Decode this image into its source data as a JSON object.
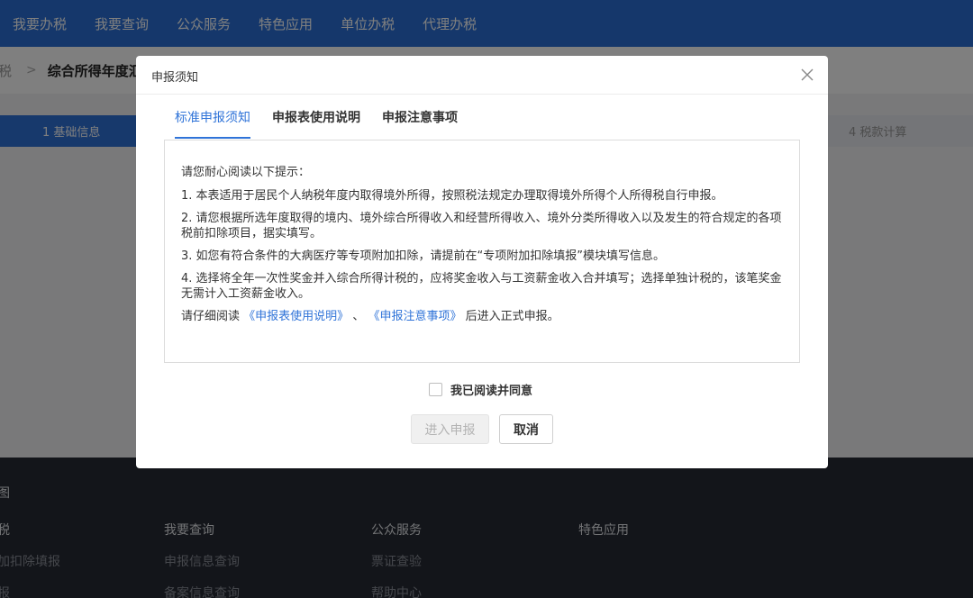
{
  "topnav": {
    "items": [
      "我要办税",
      "我要查询",
      "公众服务",
      "特色应用",
      "单位办税",
      "代理办税"
    ]
  },
  "breadcrumb": {
    "prev": "税",
    "current": "综合所得年度汇"
  },
  "steps": {
    "step1": "1 基础信息",
    "step4": "4 税款计算"
  },
  "footer": {
    "map_title": "图",
    "col1_title": "税",
    "col1_links": [
      "加扣除填报",
      "报"
    ],
    "col2_title": "我要查询",
    "col2_links": [
      "申报信息查询",
      "备案信息查询"
    ],
    "col3_title": "公众服务",
    "col3_links": [
      "票证查验",
      "帮助中心"
    ],
    "col4_title": "特色应用"
  },
  "modal": {
    "title": "申报须知",
    "tabs": [
      "标准申报须知",
      "申报表使用说明",
      "申报注意事项"
    ],
    "active_tab": 0,
    "notice": {
      "intro": "请您耐心阅读以下提示：",
      "items": [
        "1. 本表适用于居民个人纳税年度内取得境外所得，按照税法规定办理取得境外所得个人所得税自行申报。",
        "2. 请您根据所选年度取得的境内、境外综合所得收入和经营所得收入、境外分类所得收入以及发生的符合规定的各项税前扣除项目，据实填写。",
        "3. 如您有符合条件的大病医疗等专项附加扣除，请提前在“专项附加扣除填报”模块填写信息。",
        "4. 选择将全年一次性奖金并入综合所得计税的，应将奖金收入与工资薪金收入合并填写；选择单独计税的，该笔奖金无需计入工资薪金收入。"
      ],
      "closing_prefix": "请仔细阅读",
      "closing_link1": "《申报表使用说明》",
      "closing_sep": "、",
      "closing_link2": "《申报注意事项》",
      "closing_suffix": "后进入正式申报。"
    },
    "agree_label": "我已阅读并同意",
    "agree_checked": false,
    "enter_button": "进入申报",
    "cancel_button": "取消"
  },
  "colors": {
    "nav_blue": "#2a6fd6",
    "accent_blue": "#2f73d8",
    "footer_bg": "#272b34"
  },
  "icons": {
    "close": "close-icon",
    "breadcrumb_separator": "chevron-right-icon"
  }
}
